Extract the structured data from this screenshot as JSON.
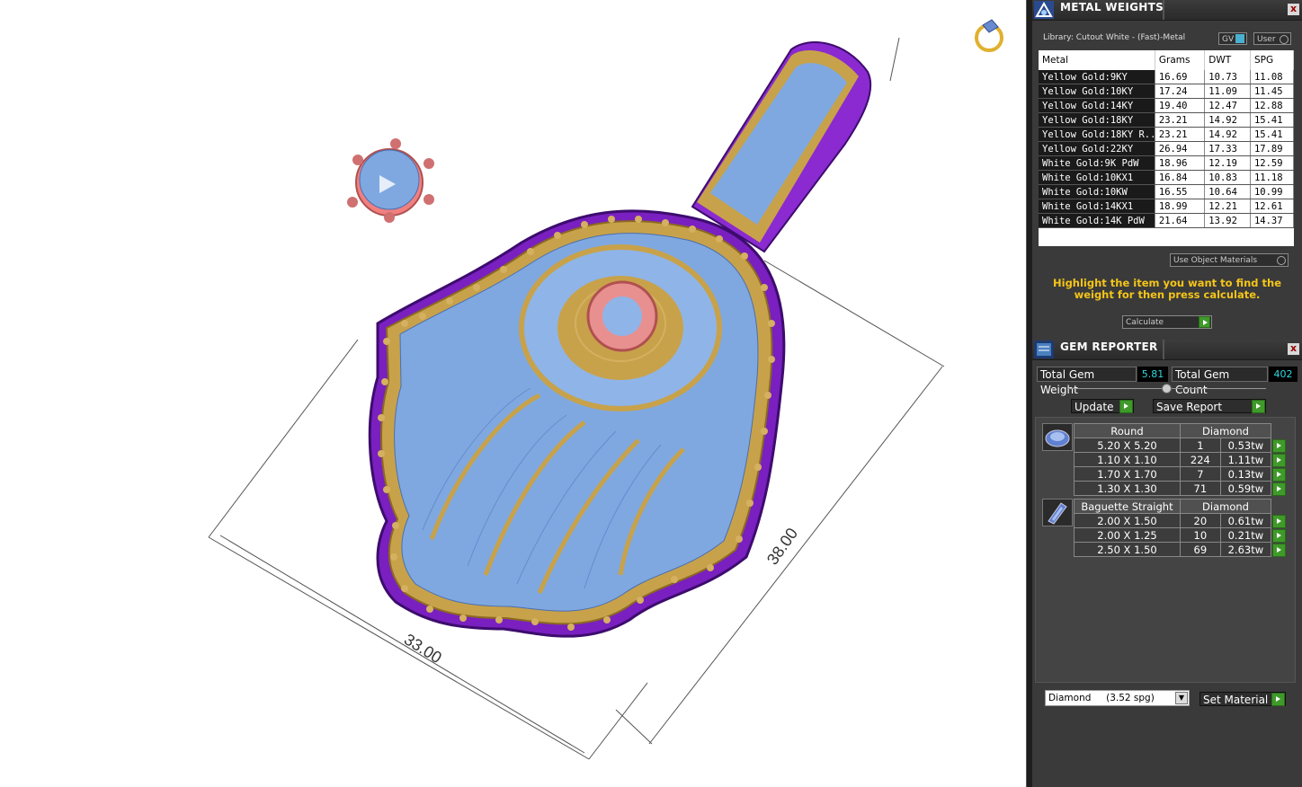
{
  "viewport": {
    "dimension_width": "33.00",
    "dimension_height": "38.00"
  },
  "metal_weights": {
    "title": "METAL WEIGHTS",
    "close": "x",
    "library": "Library: Cutout White - (Fast)-Metal",
    "gv_label": "GV",
    "user_label": "User",
    "columns": [
      "Metal",
      "Grams",
      "DWT",
      "SPG"
    ],
    "rows": [
      {
        "metal": "Yellow Gold:9KY",
        "grams": "16.69",
        "dwt": "10.73",
        "spg": "11.08"
      },
      {
        "metal": "Yellow Gold:10KY",
        "grams": "17.24",
        "dwt": "11.09",
        "spg": "11.45"
      },
      {
        "metal": "Yellow Gold:14KY",
        "grams": "19.40",
        "dwt": "12.47",
        "spg": "12.88"
      },
      {
        "metal": "Yellow Gold:18KY",
        "grams": "23.21",
        "dwt": "14.92",
        "spg": "15.41"
      },
      {
        "metal": "Yellow Gold:18KY R...",
        "grams": "23.21",
        "dwt": "14.92",
        "spg": "15.41"
      },
      {
        "metal": "Yellow Gold:22KY",
        "grams": "26.94",
        "dwt": "17.33",
        "spg": "17.89"
      },
      {
        "metal": "White Gold:9K PdW",
        "grams": "18.96",
        "dwt": "12.19",
        "spg": "12.59"
      },
      {
        "metal": "White Gold:10KX1",
        "grams": "16.84",
        "dwt": "10.83",
        "spg": "11.18"
      },
      {
        "metal": "White Gold:10KW",
        "grams": "16.55",
        "dwt": "10.64",
        "spg": "10.99"
      },
      {
        "metal": "White Gold:14KX1",
        "grams": "18.99",
        "dwt": "12.21",
        "spg": "12.61"
      },
      {
        "metal": "White Gold:14K PdW",
        "grams": "21.64",
        "dwt": "13.92",
        "spg": "14.37"
      }
    ],
    "use_object_materials": "Use Object Materials",
    "hint": "Highlight the item you want to find the weight for then press calculate.",
    "calculate": "Calculate"
  },
  "gem_reporter": {
    "title": "GEM REPORTER",
    "close": "x",
    "total_weight_label": "Total Gem Weight",
    "total_weight": "5.81",
    "total_count_label": "Total Gem Count",
    "total_count": "402",
    "update": "Update",
    "save_report": "Save Report",
    "groups": [
      {
        "shape": "Round",
        "material": "Diamond",
        "icon": "round-gem-icon",
        "rows": [
          {
            "size": "5.20 X 5.20",
            "count": "1",
            "tw": "0.53tw"
          },
          {
            "size": "1.10 X 1.10",
            "count": "224",
            "tw": "1.11tw"
          },
          {
            "size": "1.70 X 1.70",
            "count": "7",
            "tw": "0.13tw"
          },
          {
            "size": "1.30 X 1.30",
            "count": "71",
            "tw": "0.59tw"
          }
        ]
      },
      {
        "shape": "Baguette Straight",
        "material": "Diamond",
        "icon": "baguette-gem-icon",
        "rows": [
          {
            "size": "2.00 X 1.50",
            "count": "20",
            "tw": "0.61tw"
          },
          {
            "size": "2.00 X 1.25",
            "count": "10",
            "tw": "0.21tw"
          },
          {
            "size": "2.50 X 1.50",
            "count": "69",
            "tw": "2.63tw"
          }
        ]
      }
    ],
    "material_select": "Diamond     (3.52 spg)",
    "set_material": "Set Material"
  }
}
